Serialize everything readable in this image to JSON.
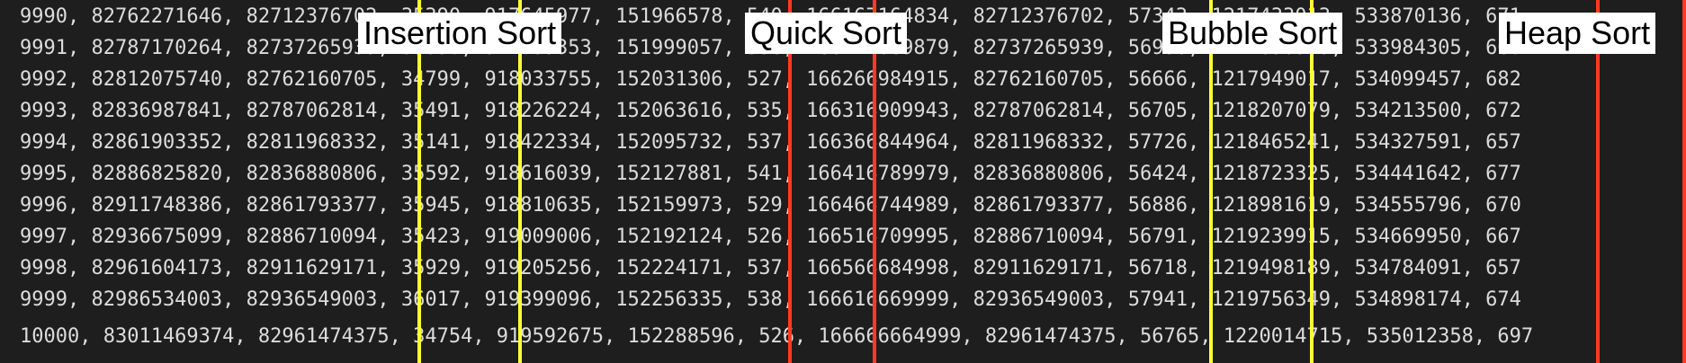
{
  "terminal": {
    "lines": [
      "9990, 82762271646, 82712376702, 35390, 917645977, 151966578, 540, 166167164834, 82712376702, 57343, 1217433013, 533870136, 671",
      "9991, 82787170264, 82737265939, 35398, 917839353, 151999057, 536, 166217069879, 82737265939, 56930, 1217690933, 533984305, 668",
      "9992, 82812075740, 82762160705, 34799, 918033755, 152031306, 527, 166266984915, 82762160705, 56666, 1217949017, 534099457, 682",
      "9993, 82836987841, 82787062814, 35491, 918226224, 152063616, 535, 166316909943, 82787062814, 56705, 1218207079, 534213500, 672",
      "9994, 82861903352, 82811968332, 35141, 918422334, 152095732, 537, 166366844964, 82811968332, 57726, 1218465241, 534327591, 657",
      "9995, 82886825820, 82836880806, 35592, 918616039, 152127881, 541, 166416789979, 82836880806, 56424, 1218723325, 534441642, 677",
      "9996, 82911748386, 82861793377, 35945, 918810635, 152159973, 529, 166466744989, 82861793377, 56886, 1218981619, 534555796, 670",
      "9997, 82936675099, 82886710094, 35423, 919009006, 152192124, 526, 166516709995, 82886710094, 56791, 1219239915, 534669950, 667",
      "9998, 82961604173, 82911629171, 35929, 919205256, 152224171, 537, 166566684998, 82911629171, 56718, 1219498189, 534784091, 657",
      "9999, 82986534003, 82936549003, 36017, 919399096, 152256335, 538, 166616669999, 82936549003, 57941, 1219756349, 534898174, 674",
      "10000, 83011469374, 82961474375, 34754, 919592675, 152288596, 526, 166666664999, 82961474375, 56765, 1220014715, 535012358, 697"
    ]
  },
  "labels": {
    "insertion": "Insertion Sort",
    "quick": "Quick Sort",
    "bubble": "Bubble Sort",
    "heap": "Heap Sort"
  },
  "colors": {
    "background": "#1e1e1e",
    "text": "#dcdcdc",
    "highlight_yellow": "#ffff33",
    "highlight_red": "#ff3b1f"
  }
}
